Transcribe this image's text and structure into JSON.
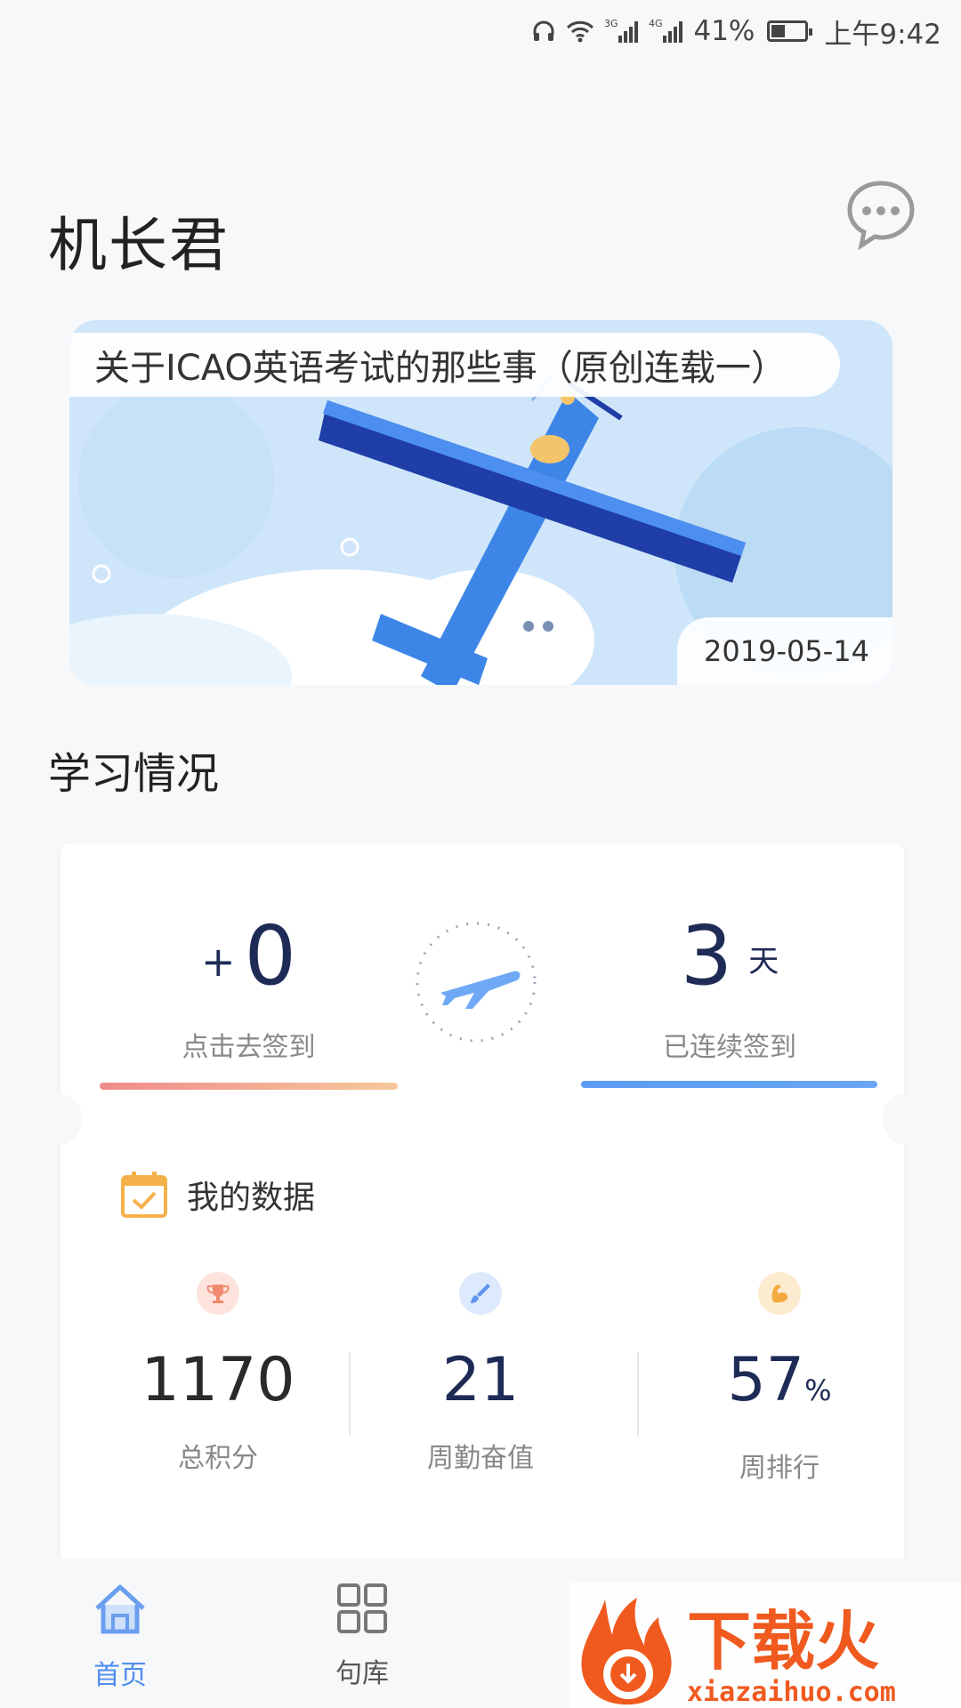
{
  "status_bar": {
    "signal_1": "3G",
    "signal_2": "4G",
    "battery": "41%",
    "battery_level": 0.41,
    "time": "上午9:42"
  },
  "header": {
    "title": "机长君",
    "chat_icon": "chat-bubble-icon"
  },
  "banner": {
    "title": "关于ICAO英语考试的那些事（原创连载一）",
    "date": "2019-05-14"
  },
  "study": {
    "section_title": "学习情况",
    "checkin": {
      "plus": "+",
      "points": "0",
      "points_label": "点击去签到",
      "days": "3",
      "days_unit": "天",
      "days_label": "已连续签到"
    },
    "my_data": {
      "title": "我的数据",
      "stats": [
        {
          "value": "1170",
          "label": "总积分",
          "icon": "trophy-icon",
          "color": "#f8a08a"
        },
        {
          "value": "21",
          "label": "周勤奋值",
          "icon": "brush-icon",
          "color": "#6fa3f2"
        },
        {
          "value": "57",
          "suffix": "%",
          "label": "周排行",
          "icon": "muscle-icon",
          "color": "#f7b65b"
        }
      ]
    }
  },
  "nav": {
    "items": [
      {
        "label": "首页",
        "icon": "home-icon",
        "active": true
      },
      {
        "label": "句库",
        "icon": "grid-icon",
        "active": false
      }
    ]
  },
  "watermark": {
    "brand": "下载火",
    "url": "xiazaihuo.com"
  },
  "colors": {
    "accent": "#4f8ef0",
    "number": "#1d2b56",
    "checkin_bar_start": "#f08b8b",
    "checkin_bar_end": "#f5c89a",
    "streak_bar": "#5a9cf5",
    "watermark": "#f05a1f"
  }
}
